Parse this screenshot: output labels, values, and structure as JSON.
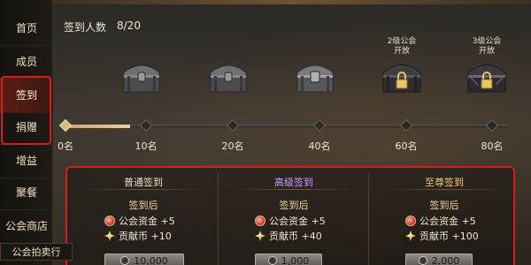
{
  "sidebar": {
    "items": [
      {
        "label": "首页"
      },
      {
        "label": "成员"
      },
      {
        "label": "签到"
      },
      {
        "label": "捐赠"
      },
      {
        "label": "增益"
      },
      {
        "label": "聚餐"
      },
      {
        "label": "公会商店"
      }
    ],
    "bottom_label": "公会拍卖行"
  },
  "header": {
    "label": "签到人数",
    "count": "8/20"
  },
  "progress": {
    "current": 8,
    "max": 80,
    "ticks": [
      "0名",
      "10名",
      "20名",
      "40名",
      "60名",
      "80名"
    ],
    "chests": [
      {
        "name": "chest-10",
        "label": "",
        "locked": false
      },
      {
        "name": "chest-20",
        "label": "",
        "locked": false
      },
      {
        "name": "chest-40",
        "label": "",
        "locked": false
      },
      {
        "name": "chest-60",
        "label_line1": "2级公会",
        "label_line2": "开放",
        "locked": true
      },
      {
        "name": "chest-80",
        "label_line1": "3级公会",
        "label_line2": "开放",
        "locked": true
      }
    ]
  },
  "cards": [
    {
      "title": "普通签到",
      "after": "签到后",
      "fund_label": "公会资金 +5",
      "coin_label": "贡献币 +10",
      "cost": "10,000"
    },
    {
      "title": "高级签到",
      "after": "签到后",
      "fund_label": "公会资金 +5",
      "coin_label": "贡献币 +40",
      "cost": "1,000"
    },
    {
      "title": "至尊签到",
      "after": "签到后",
      "fund_label": "公会资金 +5",
      "coin_label": "贡献币 +100",
      "cost": "2,000"
    }
  ],
  "colors": {
    "highlight_border": "#d11f1f",
    "progress_fill": "#d8b888",
    "premium_title": "#c89bff",
    "supreme_title": "#f1cd86"
  }
}
